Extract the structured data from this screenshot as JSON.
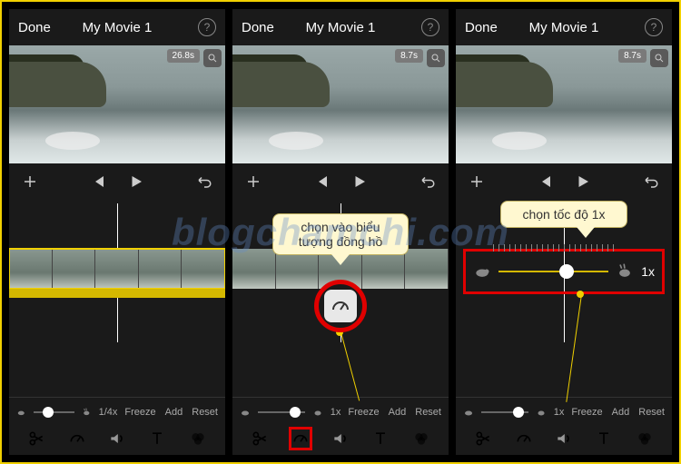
{
  "header": {
    "done": "Done",
    "title": "My Movie 1"
  },
  "screens": [
    {
      "duration": "26.8s",
      "speedLabel": "1/4x"
    },
    {
      "duration": "8.7s",
      "speedLabel": "1x"
    },
    {
      "duration": "8.7s",
      "speedLabel": "1x"
    }
  ],
  "speedStrip": {
    "freeze": "Freeze",
    "add": "Add",
    "reset": "Reset"
  },
  "callouts": {
    "speedIcon": "chọn vào biểu tượng đồng hồ",
    "speed1x": "chọn tốc độ 1x"
  },
  "speedSlider": {
    "value": "1x"
  },
  "watermark": "blogchamchi.com"
}
